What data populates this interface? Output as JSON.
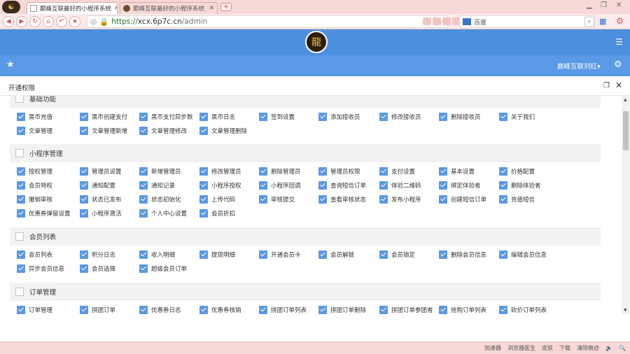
{
  "browser": {
    "tabs": [
      {
        "label": "巅峰互联最好的小程序系统"
      },
      {
        "label": "巅峰互联最好的小程序系统"
      }
    ],
    "url": {
      "scheme": "https://",
      "host": "xcx.6p7c.cn",
      "path": "/admin"
    },
    "search_placeholder": "百度"
  },
  "app": {
    "user": "巅峰互联刘红▾"
  },
  "dialog": {
    "title": "开通权限"
  },
  "sections": [
    {
      "title": "基础功能",
      "items": [
        "黑币充值",
        "黑币创建支付",
        "黑币支付异步数",
        "黑币日志",
        "签到设置",
        "添加接收员",
        "修改接收员",
        "删除接收员",
        "关于我们",
        "文章管理",
        "文章管理新增",
        "文章管理修改",
        "文章管理删除"
      ]
    },
    {
      "title": "小程序管理",
      "items": [
        "授权管理",
        "管理员设置",
        "新增管理员",
        "修改管理员",
        "删除管理员",
        "管理员权限",
        "支付设置",
        "基本设置",
        "价格配置",
        "会员特权",
        "通知配置",
        "通知记录",
        "小程序授权",
        "小程序回调",
        "查询短信订单",
        "体验二维码",
        "绑定体验者",
        "删除体验者",
        "撤销审核",
        "状态已发布",
        "状态初始化",
        "上传代码",
        "审核提交",
        "查看审核状态",
        "发布小程序",
        "创建短信订单",
        "充值短信",
        "优惠券弹窗设置",
        "小程序激活",
        "个人中心设置",
        "会员折扣"
      ]
    },
    {
      "title": "会员列表",
      "items": [
        "会员列表",
        "积分日志",
        "收入明细",
        "提现明细",
        "开通会员卡",
        "会员解锁",
        "会员锁定",
        "删除会员信息",
        "编辑会员信息",
        "异步会员信息",
        "会员选择",
        "超级会员订单"
      ]
    },
    {
      "title": "订单管理",
      "items": [
        "订单管理",
        "拼团订单",
        "优惠券日志",
        "优惠券核销",
        "拼团订单列表",
        "拼团订单删除",
        "拼团订单参团者",
        "抢购订单列表",
        "砍价订单列表"
      ]
    }
  ],
  "statusbar": [
    "加速器",
    "浏览器医生",
    "皮肤",
    "下载",
    "清除痕迹",
    "🔉",
    "🔍"
  ]
}
